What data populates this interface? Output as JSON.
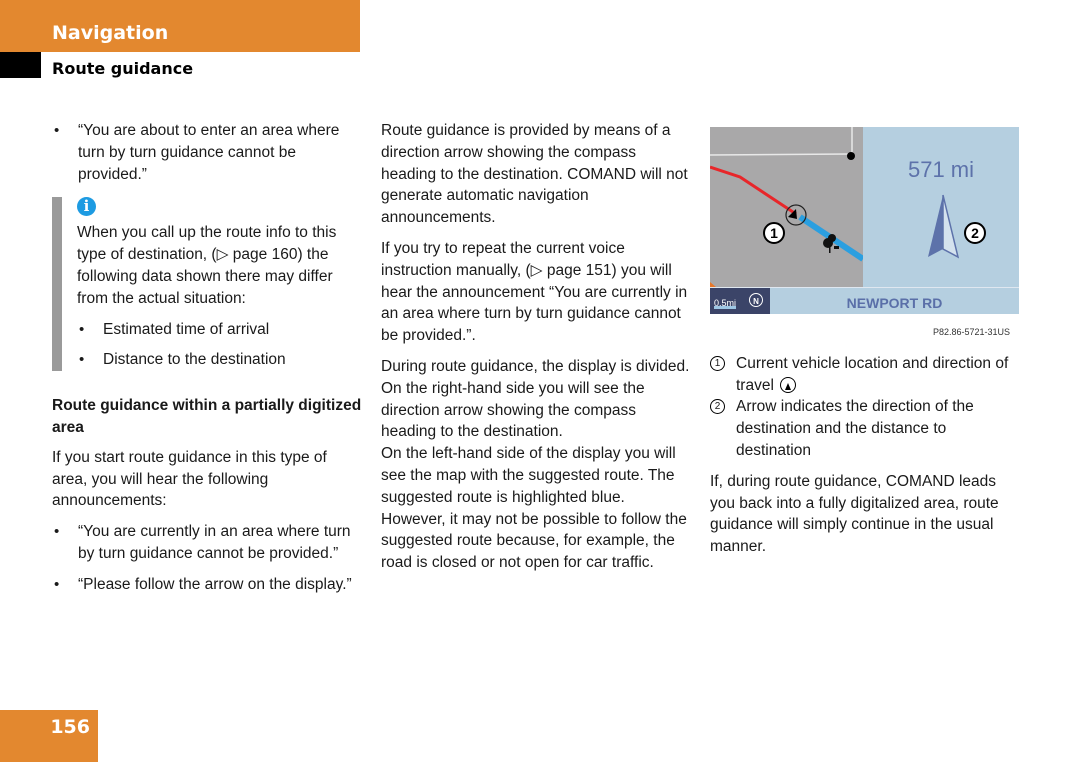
{
  "header": {
    "section": "Navigation",
    "subsection": "Route guidance",
    "accent_color": "#e3882f"
  },
  "column1": {
    "bullets_top": [
      "“You are about to enter an area where turn by turn guidance cannot be provided.”"
    ],
    "note": {
      "icon": "info-icon",
      "text": "When you call up the route info to this type of destination, (▷ page 160) the following data shown there may differ from the actual situation:",
      "bullets": [
        "Estimated time of arrival",
        "Distance to the destination"
      ]
    },
    "heading": "Route guidance within a partially digitized area",
    "intro": "If you start route guidance in this type of area, you will hear the following announcements:",
    "bullets_bottom": [
      "“You are currently in an area where turn by turn guidance cannot be provided.”",
      "“Please follow the arrow on the display.”"
    ]
  },
  "column2": {
    "paragraphs": [
      "Route guidance is provided by means of a direction arrow showing the compass heading to the destination. COMAND will not generate automatic navigation announcements.",
      "If you try to repeat the current voice instruction manually, (▷ page 151) you will hear the announcement “You are currently in an area where turn by turn guidance cannot be provided.”.",
      "During route guidance, the display is divided. On the right-hand side you will see the direction arrow showing the compass heading to the destination.",
      "On the left-hand side of the display you will see the map with the suggested route. The suggested route is highlighted blue. However, it may not be possible to follow the suggested route because, for example, the road is closed or not open for car traffic."
    ]
  },
  "figure": {
    "distance": "571 mi",
    "street": "NEWPORT RD",
    "scale": "0.5mi",
    "north_label": "N",
    "callout_1": "1",
    "callout_2": "2",
    "code": "P82.86-5721-31US",
    "colors": {
      "route_traveled": "#e8262a",
      "route_suggested": "#2b9fe0",
      "map_bg": "#a9a8a9",
      "panel_bg": "#b5cfe0",
      "arrow": "#5d72aa"
    }
  },
  "column3": {
    "legend": [
      {
        "num": "1",
        "text": "Current vehicle location and direction of travel"
      },
      {
        "num": "2",
        "text": "Arrow indicates the direction of the destination and the distance to destination"
      }
    ],
    "closing": "If, during route guidance, COMAND leads you back into a fully digitalized area, route guidance will simply continue in the usual manner."
  },
  "footer": {
    "page_number": "156"
  }
}
